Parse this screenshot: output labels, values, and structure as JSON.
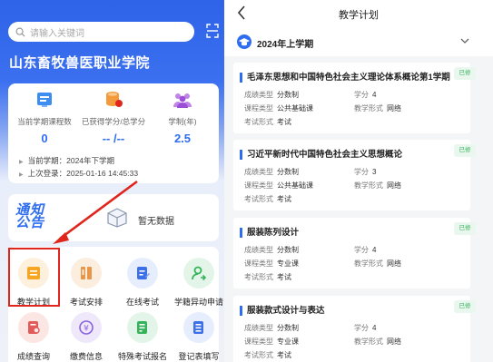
{
  "left": {
    "search": {
      "placeholder": "请输入关键词"
    },
    "school_name": "山东畜牧兽医职业学院",
    "stats": [
      {
        "icon": "course-count-icon",
        "label": "当前学期课程数",
        "value": "0"
      },
      {
        "icon": "credit-coins-icon",
        "label": "已获得学分/总学分",
        "value": "-- /--"
      },
      {
        "icon": "people-icon",
        "label": "学制(年)",
        "value": "2.5"
      }
    ],
    "info": {
      "semester": "当前学期：2024年下学期",
      "last_login": "上次登录：2025-01-16 14:45:33"
    },
    "notice": {
      "logo_line1": "通知",
      "logo_line2": "公告",
      "empty_text": "暂无数据"
    },
    "menu": [
      {
        "label": "教学计划",
        "icon": "teaching-plan-icon",
        "color": "#f6a623",
        "bg": "#fdf1dd"
      },
      {
        "label": "考试安排",
        "icon": "exam-schedule-icon",
        "color": "#e8974a",
        "bg": "#fbeede"
      },
      {
        "label": "在线考试",
        "icon": "online-exam-icon",
        "color": "#3d6fe6",
        "bg": "#e6edfc"
      },
      {
        "label": "学籍异动申请",
        "icon": "status-change-icon",
        "color": "#35b35a",
        "bg": "#e3f5e8"
      },
      {
        "label": "成绩查询",
        "icon": "grade-query-icon",
        "color": "#e25b5b",
        "bg": "#fbe6e4"
      },
      {
        "label": "缴费信息",
        "icon": "payment-icon",
        "color": "#8a62e0",
        "bg": "#efe8fb"
      },
      {
        "label": "特殊考试报名",
        "icon": "special-exam-icon",
        "color": "#35b35a",
        "bg": "#e3f5e8"
      },
      {
        "label": "登记表填写",
        "icon": "form-fill-icon",
        "color": "#3d6fe6",
        "bg": "#e6edfc"
      }
    ]
  },
  "right": {
    "title": "教学计划",
    "semester": "2024年上学期",
    "courses": [
      {
        "name": "毛泽东思想和中国特色社会主义理论体系概论第1学期",
        "tag": "已修",
        "grading": "分数制",
        "credit": "4",
        "course_type": "公共基础课",
        "teaching_form": "网络",
        "exam_form": "考试"
      },
      {
        "name": "习近平新时代中国特色社会主义思想概论",
        "tag": "已修",
        "grading": "分数制",
        "credit": "3",
        "course_type": "公共基础课",
        "teaching_form": "网络",
        "exam_form": "考试"
      },
      {
        "name": "服装陈列设计",
        "tag": "已修",
        "grading": "分数制",
        "credit": "4",
        "course_type": "专业课",
        "teaching_form": "网络",
        "exam_form": "考试"
      },
      {
        "name": "服装款式设计与表达",
        "tag": "已修",
        "grading": "分数制",
        "credit": "4",
        "course_type": "专业课",
        "teaching_form": "网络",
        "exam_form": "考试"
      }
    ],
    "field_labels": {
      "grading": "成绩类型",
      "credit": "学分",
      "course_type": "课程类型",
      "teaching_form": "教学形式",
      "exam_form": "考试形式"
    }
  }
}
